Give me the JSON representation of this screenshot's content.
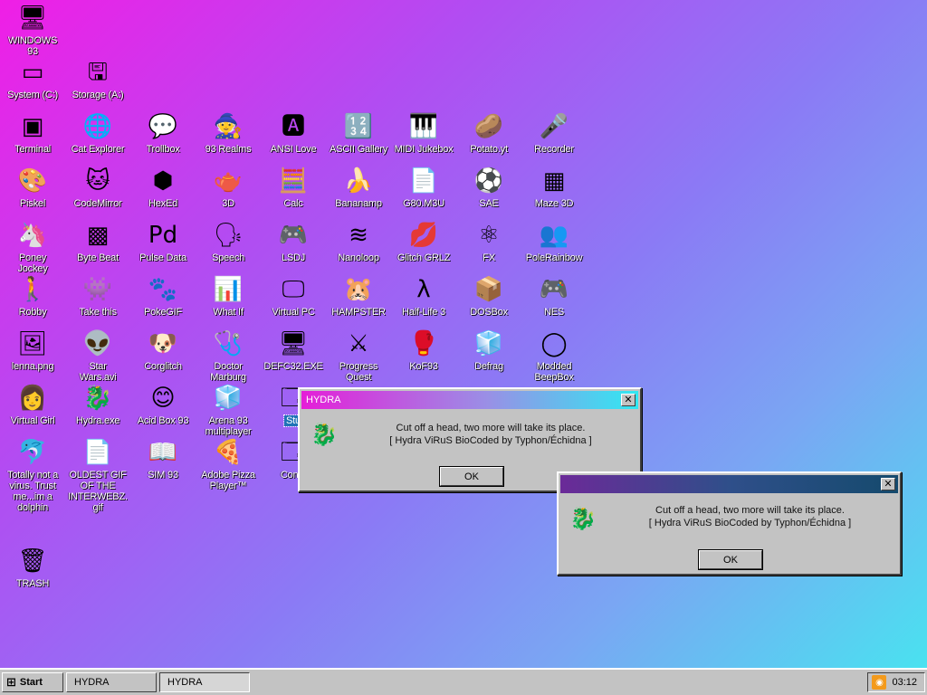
{
  "desktop": {
    "icons": [
      {
        "label": "WINDOWS 93",
        "glyph": "🖥"
      },
      {
        "label": "System (C:)",
        "glyph": "▭"
      },
      {
        "label": "Storage (A:)",
        "glyph": "🖫"
      },
      {
        "label": "Terminal",
        "glyph": "▣"
      },
      {
        "label": "Cat Explorer",
        "glyph": "🌐"
      },
      {
        "label": "Trollbox",
        "glyph": "💬"
      },
      {
        "label": "93 Realms",
        "glyph": "🧙"
      },
      {
        "label": "ANSI Love",
        "glyph": "🅰"
      },
      {
        "label": "ASCII Gallery",
        "glyph": "🔢"
      },
      {
        "label": "MIDI Jukebox",
        "glyph": "🎹"
      },
      {
        "label": "Potato.yt",
        "glyph": "🥔"
      },
      {
        "label": "Recorder",
        "glyph": "🎤"
      },
      {
        "label": "Piskel",
        "glyph": "🎨"
      },
      {
        "label": "CodeMirror",
        "glyph": "🐱"
      },
      {
        "label": "HexEd",
        "glyph": "⬢"
      },
      {
        "label": "3D",
        "glyph": "🫖"
      },
      {
        "label": "Calc",
        "glyph": "🧮"
      },
      {
        "label": "Bananamp",
        "glyph": "🍌"
      },
      {
        "label": "G80.M3U",
        "glyph": "📄"
      },
      {
        "label": "SAE",
        "glyph": "⚽"
      },
      {
        "label": "Maze 3D",
        "glyph": "▦"
      },
      {
        "label": "Poney\nJockey",
        "glyph": "🦄"
      },
      {
        "label": "Byte Beat",
        "glyph": "▩"
      },
      {
        "label": "Pulse Data",
        "glyph": "Pd"
      },
      {
        "label": "Speech",
        "glyph": "🗣"
      },
      {
        "label": "LSDJ",
        "glyph": "🎮"
      },
      {
        "label": "Nanoloop",
        "glyph": "≋"
      },
      {
        "label": "Glitch GRLZ",
        "glyph": "💋"
      },
      {
        "label": "FX",
        "glyph": "⚛"
      },
      {
        "label": "PoleRainbow",
        "glyph": "👥"
      },
      {
        "label": "Robby",
        "glyph": "🚶"
      },
      {
        "label": "Take this",
        "glyph": "👾"
      },
      {
        "label": "PokeGIF",
        "glyph": "🐾"
      },
      {
        "label": "What If",
        "glyph": "📊"
      },
      {
        "label": "Virtual PC",
        "glyph": "🖵"
      },
      {
        "label": "HAMPSTER",
        "glyph": "🐹"
      },
      {
        "label": "Half-Life 3",
        "glyph": "λ"
      },
      {
        "label": "DOSBox",
        "glyph": "📦"
      },
      {
        "label": "NES",
        "glyph": "🎮"
      },
      {
        "label": "lenna.png",
        "glyph": "🖼"
      },
      {
        "label": "Star\nWars.avi",
        "glyph": "👽"
      },
      {
        "label": "Corglitch",
        "glyph": "🐶"
      },
      {
        "label": "Doctor\nMarburg",
        "glyph": "🩺"
      },
      {
        "label": "DEFC32.EXE",
        "glyph": "🖥"
      },
      {
        "label": "Progress\nQuest",
        "glyph": "⚔"
      },
      {
        "label": "KoF93",
        "glyph": "🥊"
      },
      {
        "label": "Defrag",
        "glyph": "🧊"
      },
      {
        "label": "Modded\nBeepBox",
        "glyph": "◯"
      },
      {
        "label": "Virtual Girl",
        "glyph": "👩"
      },
      {
        "label": "Hydra.exe",
        "glyph": "🐉"
      },
      {
        "label": "Acid Box 93",
        "glyph": "😊"
      },
      {
        "label": "Arena 93\nmultiplayer",
        "glyph": "🧊"
      },
      {
        "label": "Stu",
        "glyph": "🗔"
      },
      {
        "label": "Totally not a\nvirus. Trust\nme...im a\ndolphin",
        "glyph": "🐬"
      },
      {
        "label": "OLDEST GIF\nOF THE\nINTERWEBZ.\ngif",
        "glyph": "📄"
      },
      {
        "label": "SIM 93",
        "glyph": "📖"
      },
      {
        "label": "Adobe Pizza\nPlayer™",
        "glyph": "🍕"
      },
      {
        "label": "Conta",
        "glyph": "🗔"
      },
      {
        "label": "TRASH",
        "glyph": "🗑"
      }
    ]
  },
  "dialogs": [
    {
      "title": "HYDRA",
      "close_glyph": "✕",
      "icon": "🐉",
      "message_line1": "Cut off a head, two more will take its place.",
      "message_line2": "[ Hydra ViRuS BioCoded by Typhon/Échidna ]",
      "ok_label": "OK"
    },
    {
      "title": "",
      "close_glyph": "✕",
      "icon": "🐉",
      "message_line1": "Cut off a head, two more will take its place.",
      "message_line2": "[ Hydra ViRuS BioCoded by Typhon/Échidna ]",
      "ok_label": "OK"
    }
  ],
  "taskbar": {
    "start_label": "Start",
    "start_icon": "⊞",
    "tasks": [
      "HYDRA",
      "HYDRA"
    ],
    "tray_icon": "rss-icon",
    "clock": "03:12"
  }
}
